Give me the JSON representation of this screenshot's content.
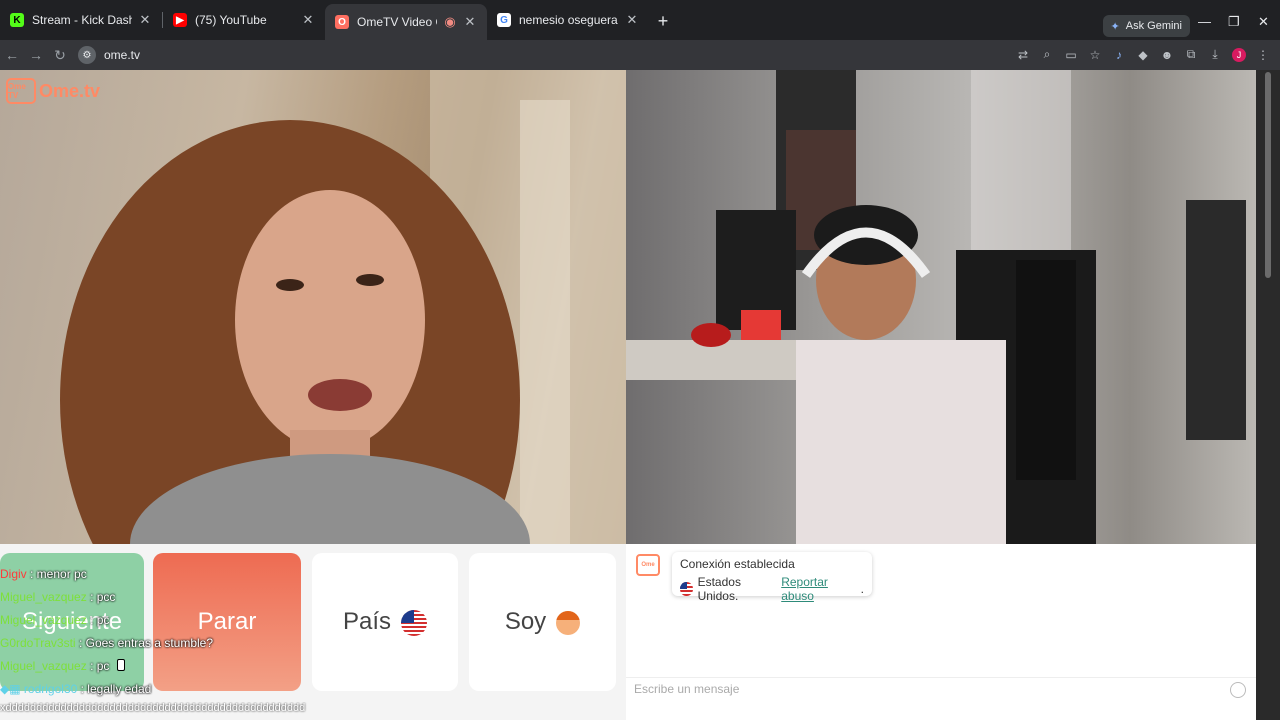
{
  "browser": {
    "tabs": [
      {
        "title": "Stream - Kick Dashboard",
        "icon": "kick-icon",
        "color": "#53fc18",
        "active": false
      },
      {
        "title": "(75) YouTube",
        "icon": "youtube-icon",
        "color": "#ff0000",
        "active": false
      },
      {
        "title": "OmeTV Video Chat — Ome",
        "icon": "ometv-icon",
        "color": "#ff6f61",
        "active": true
      },
      {
        "title": "nemesio oseguera cervantes - G",
        "icon": "google-icon",
        "color": "#4285f4",
        "active": false
      }
    ],
    "ask_gemini": "Ask Gemini",
    "url": "ome.tv",
    "profile_initial": "J"
  },
  "video": {
    "logo_text": "Ome.tv",
    "logo_box_text": "Ome TV"
  },
  "controls": {
    "next_label": "Siguiente",
    "stop_label": "Parar",
    "country_label": "País",
    "me_label": "Soy"
  },
  "stream_chat": [
    {
      "user": "Digiv",
      "msg": ": menor pc",
      "style": "red"
    },
    {
      "user": "Miguel_vazquez",
      "msg": ": pcc",
      "style": "green"
    },
    {
      "user": "Miguel_vazquez",
      "msg": ": pc",
      "style": "green"
    },
    {
      "user": "G0rdoTrav3sti",
      "msg": ": Goes entras a stumble?",
      "style": "green"
    },
    {
      "user": "Miguel_vazquez",
      "msg": ": pc",
      "style": "green"
    },
    {
      "user": "rodrigol30",
      "msg": ": legally edad",
      "style": "cyan"
    }
  ],
  "overlay_text": "xddddddddddddddddddddddddddddddddddddddddddddddddd",
  "chat_panel": {
    "status": "Conexión establecida",
    "country": "Estados Unidos.",
    "report": "Reportar abuso",
    "report_suffix": ".",
    "placeholder": "Escribe un mensaje"
  },
  "colors": {
    "next_button": "#8ed0a5",
    "stop_button": "#ee6b52",
    "accent": "#ff8a65"
  }
}
